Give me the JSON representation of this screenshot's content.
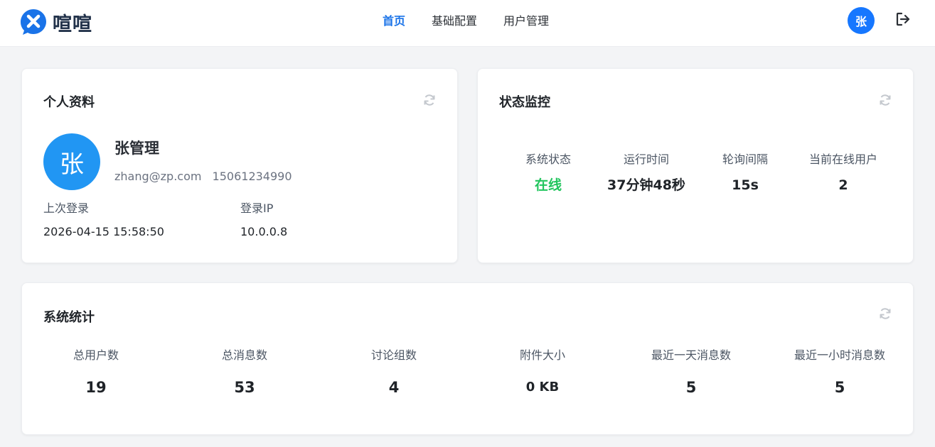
{
  "app": {
    "name": "喧喧"
  },
  "nav": {
    "items": [
      "首页",
      "基础配置",
      "用户管理"
    ],
    "active_index": 0
  },
  "header": {
    "avatar_text": "张"
  },
  "profile": {
    "title": "个人资料",
    "avatar_text": "张",
    "name": "张管理",
    "email": "zhang@zp.com",
    "phone": "15061234990",
    "last_login_label": "上次登录",
    "last_login_value": "2026-04-15 15:58:50",
    "login_ip_label": "登录IP",
    "login_ip_value": "10.0.0.8"
  },
  "status": {
    "title": "状态监控",
    "items": [
      {
        "label": "系统状态",
        "value": "在线"
      },
      {
        "label": "运行时间",
        "value": "37分钟48秒"
      },
      {
        "label": "轮询间隔",
        "value": "15s"
      },
      {
        "label": "当前在线用户",
        "value": "2"
      }
    ]
  },
  "stats": {
    "title": "系统统计",
    "items": [
      {
        "label": "总用户数",
        "value": "19"
      },
      {
        "label": "总消息数",
        "value": "53"
      },
      {
        "label": "讨论组数",
        "value": "4"
      },
      {
        "label": "附件大小",
        "value": "0 KB"
      },
      {
        "label": "最近一天消息数",
        "value": "5"
      },
      {
        "label": "最近一小时消息数",
        "value": "5"
      }
    ]
  },
  "colors": {
    "accent": "#1a73e8",
    "avatar_header": "#1677ff",
    "avatar_profile": "#2196f3",
    "online": "#22c55e",
    "background": "#f3f4f6"
  },
  "icons": {
    "logo": "xuanxuan-logo-icon",
    "logout": "logout-icon",
    "refresh": "refresh-icon"
  }
}
